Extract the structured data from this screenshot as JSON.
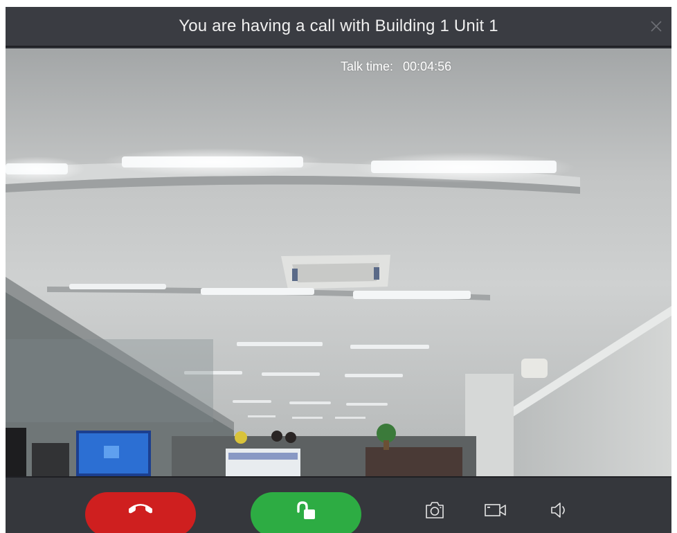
{
  "window": {
    "title": "You are having a call with Building 1 Unit 1",
    "close_icon": "close-icon"
  },
  "video": {
    "talk_time_label": "Talk time:",
    "talk_time_value": "00:04:56",
    "scene": "office-ceiling-camera-feed"
  },
  "controls": {
    "hangup": {
      "icon": "phone-hangup-icon",
      "color": "#cf1f1f"
    },
    "unlock": {
      "icon": "unlock-icon",
      "color": "#2dac43"
    },
    "snapshot": {
      "icon": "camera-icon"
    },
    "record": {
      "icon": "video-record-icon"
    },
    "volume": {
      "icon": "speaker-icon"
    }
  }
}
